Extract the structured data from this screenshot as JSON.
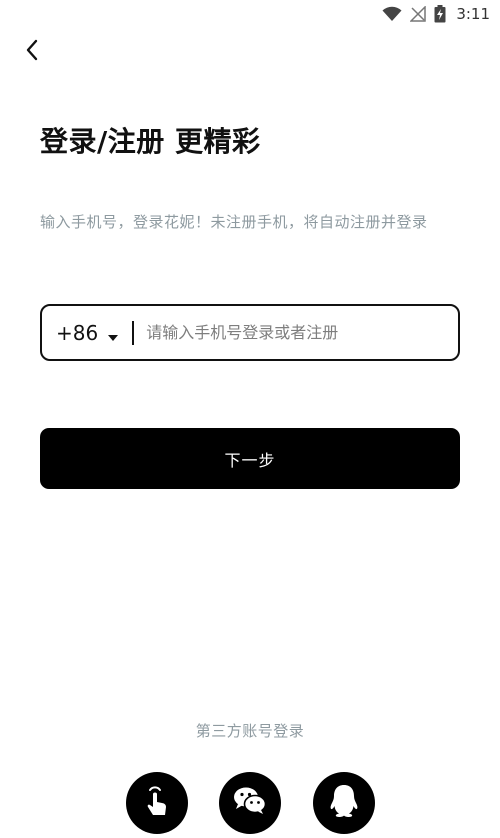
{
  "status_bar": {
    "time": "3:11",
    "icons": [
      "wifi-icon",
      "no-signal-icon",
      "battery-charging-icon"
    ]
  },
  "header": {
    "back_icon": "chevron-left-icon"
  },
  "main": {
    "title": "登录/注册 更精彩",
    "subtitle": "输入手机号，登录花妮！未注册手机，将自动注册并登录",
    "phone": {
      "country_code": "+86",
      "value": "",
      "placeholder": "请输入手机号登录或者注册"
    },
    "next_button_label": "下一步"
  },
  "third_party": {
    "label": "第三方账号登录",
    "options": [
      {
        "icon": "finger-tap-icon"
      },
      {
        "icon": "wechat-icon"
      },
      {
        "icon": "qq-icon"
      }
    ]
  }
}
